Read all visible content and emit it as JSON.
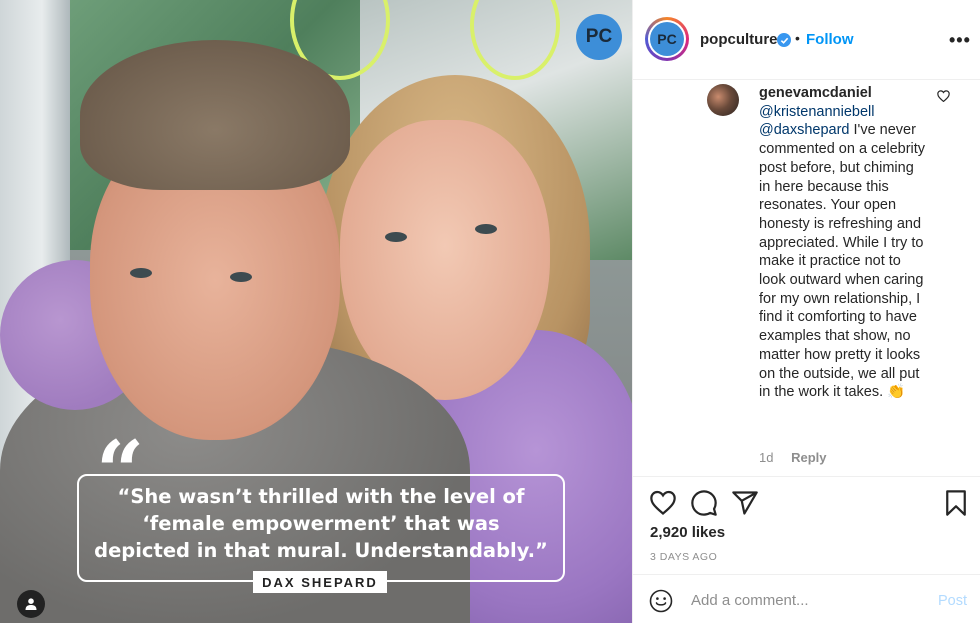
{
  "photo": {
    "badge": "PC",
    "quote_mark": "“",
    "quote_text": "“She wasn’t thrilled with the level of ‘female empowerment’ that was depicted in that mural. Understandably.”",
    "author": "DAX SHEPARD"
  },
  "header": {
    "avatar_text": "PC",
    "username": "popculture",
    "separator": "•",
    "follow_label": "Follow",
    "more_label": "•••"
  },
  "comment": {
    "username": "genevamcdaniel",
    "mention1": "@kristenanniebell",
    "mention2": "@daxshepard",
    "text": " I've never commented on a celebrity post before, but chiming in here because this resonates. Your open honesty is refreshing and appreciated. While I try to make it practice not to look outward when caring for my own relationship, I find it comforting to have examples that show, no matter how pretty it looks on the outside, we all put in the work it takes. 👏",
    "age": "1d",
    "reply_label": "Reply"
  },
  "actions": {
    "likes": "2,920 likes",
    "time": "3 DAYS AGO"
  },
  "add_comment": {
    "placeholder": "Add a comment...",
    "post_label": "Post"
  },
  "colors": {
    "link_blue": "#0095f6",
    "mention_blue": "#00376b",
    "badge_blue": "#3d8ed8"
  }
}
